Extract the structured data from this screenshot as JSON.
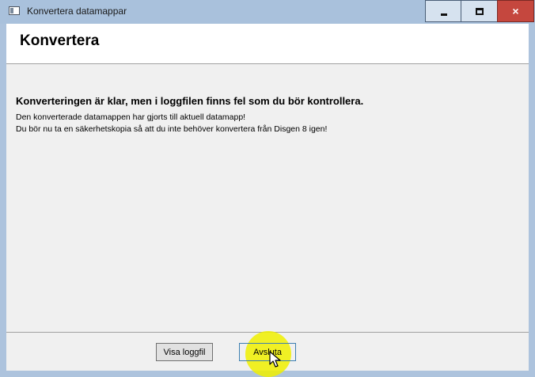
{
  "window": {
    "title": "Konvertera datamappar",
    "controls": {
      "minimize": "minimize-icon",
      "maximize": "maximize-icon",
      "close": "×"
    }
  },
  "page": {
    "title": "Konvertera"
  },
  "message": {
    "heading": "Konverteringen är klar, men i loggfilen finns fel som du bör kontrollera.",
    "line1": "Den konverterade datamappen har gjorts till aktuell datamapp!",
    "line2": "Du bör nu ta en säkerhetskopia så att du inte behöver konvertera från Disgen 8 igen!"
  },
  "buttons": {
    "show_log": "Visa loggfil",
    "finish": "Avsluta"
  },
  "colors": {
    "titlebar": "#a9c1dc",
    "close_button": "#c5473e",
    "highlight": "#f0f000"
  }
}
